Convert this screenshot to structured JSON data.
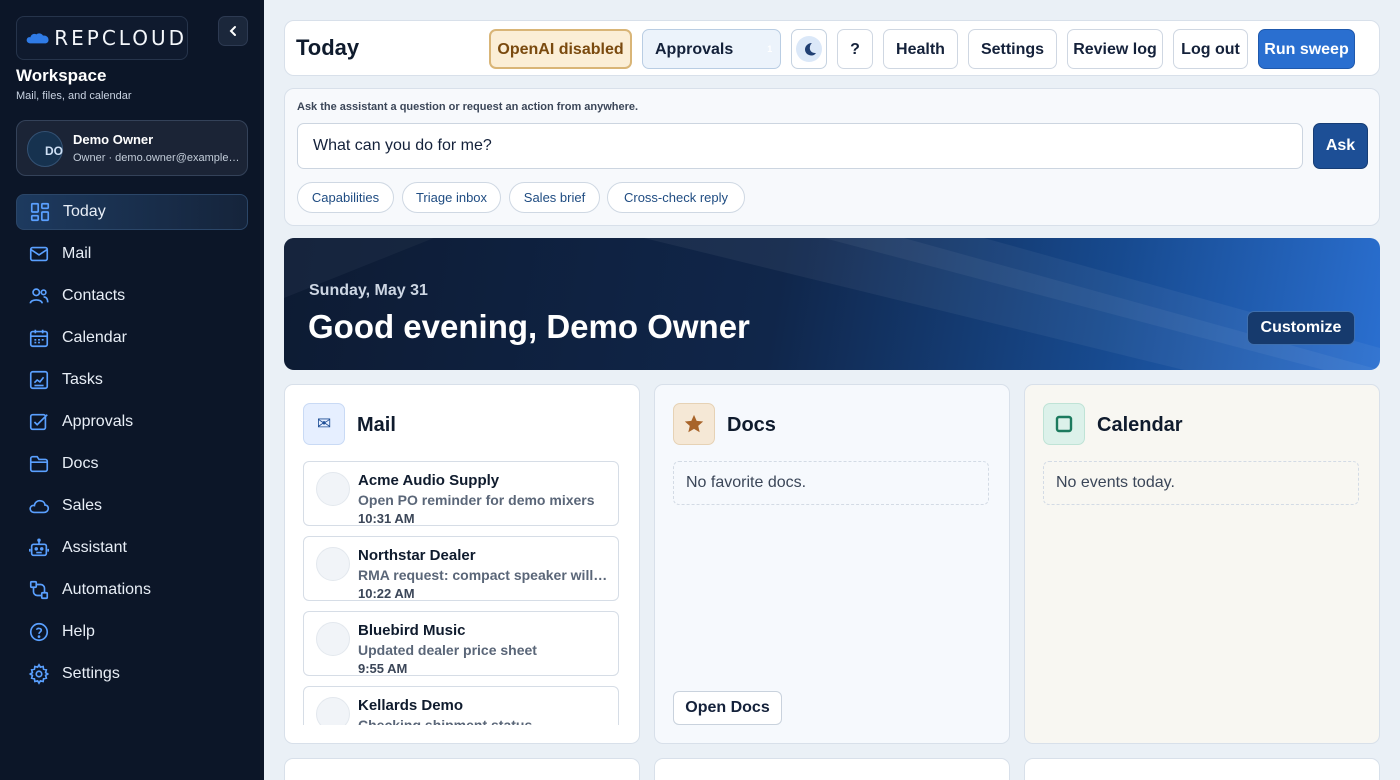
{
  "app": {
    "logo_text": "RepCloud",
    "workspace_title": "Workspace",
    "workspace_subtitle": "Mail, files, and calendar"
  },
  "user": {
    "initials": "DO",
    "name": "Demo Owner",
    "subtitle": "Owner · demo.owner@example.com"
  },
  "nav": [
    {
      "label": "Today",
      "icon": "dashboard-icon",
      "active": true
    },
    {
      "label": "Mail",
      "icon": "mail-icon"
    },
    {
      "label": "Contacts",
      "icon": "contacts-icon"
    },
    {
      "label": "Calendar",
      "icon": "calendar-icon"
    },
    {
      "label": "Tasks",
      "icon": "tasks-icon"
    },
    {
      "label": "Approvals",
      "icon": "approvals-icon"
    },
    {
      "label": "Docs",
      "icon": "folder-icon"
    },
    {
      "label": "Sales",
      "icon": "cloud-icon"
    },
    {
      "label": "Assistant",
      "icon": "robot-icon"
    },
    {
      "label": "Automations",
      "icon": "automation-icon"
    },
    {
      "label": "Help",
      "icon": "help-icon"
    },
    {
      "label": "Settings",
      "icon": "gear-icon"
    }
  ],
  "topbar": {
    "title": "Today",
    "openai_status": "OpenAI disabled",
    "approvals_label": "Approvals",
    "approvals_count": "1",
    "help_label": "?",
    "health_label": "Health",
    "settings_label": "Settings",
    "review_log_label": "Review log",
    "logout_label": "Log out",
    "run_sweep_label": "Run sweep"
  },
  "assistant": {
    "prompt_label": "Ask the assistant a question or request an action from anywhere.",
    "input_value": "What can you do for me?",
    "ask_label": "Ask",
    "chips": [
      "Capabilities",
      "Triage inbox",
      "Sales brief",
      "Cross-check reply"
    ]
  },
  "hero": {
    "date": "Sunday, May 31",
    "greeting": "Good evening, Demo Owner",
    "customize_label": "Customize"
  },
  "cards": {
    "mail": {
      "title": "Mail",
      "icon": "envelope-icon",
      "items": [
        {
          "from": "Acme Audio Supply",
          "subject": "Open PO reminder for demo mixers",
          "time": "10:31 AM"
        },
        {
          "from": "Northstar Dealer",
          "subject": "RMA request: compact speaker will not power on",
          "time": "10:22 AM"
        },
        {
          "from": "Bluebird Music",
          "subject": "Updated dealer price sheet",
          "time": "9:55 AM"
        },
        {
          "from": "Kellards Demo",
          "subject": "Checking shipment status",
          "time": ""
        }
      ]
    },
    "docs": {
      "title": "Docs",
      "icon": "star-icon",
      "empty_text": "No favorite docs.",
      "open_label": "Open Docs"
    },
    "calendar": {
      "title": "Calendar",
      "icon": "square-icon",
      "empty_text": "No events today."
    }
  },
  "colors": {
    "sidebar_bg": "#0c1628",
    "accent": "#2a6fd0",
    "ask_button": "#1d4f96",
    "warning_bg": "#fbeed6"
  }
}
